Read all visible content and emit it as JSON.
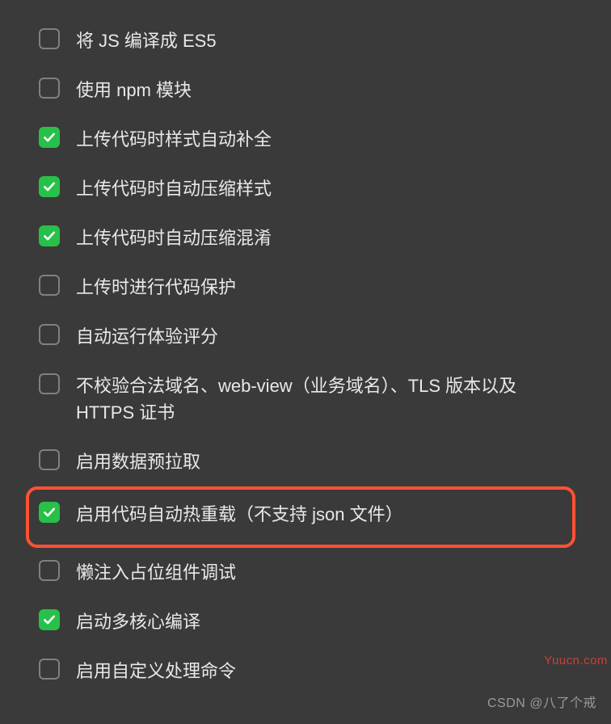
{
  "options": [
    {
      "label": "将 JS 编译成 ES5",
      "checked": false
    },
    {
      "label": "使用 npm 模块",
      "checked": false
    },
    {
      "label": "上传代码时样式自动补全",
      "checked": true
    },
    {
      "label": "上传代码时自动压缩样式",
      "checked": true
    },
    {
      "label": "上传代码时自动压缩混淆",
      "checked": true
    },
    {
      "label": "上传时进行代码保护",
      "checked": false
    },
    {
      "label": "自动运行体验评分",
      "checked": false
    },
    {
      "label": "不校验合法域名、web-view（业务域名）、TLS 版本以及 HTTPS 证书",
      "checked": false
    },
    {
      "label": "启用数据预拉取",
      "checked": false
    },
    {
      "label": "启用代码自动热重载（不支持 json 文件）",
      "checked": true,
      "highlighted": true
    },
    {
      "label": "懒注入占位组件调试",
      "checked": false
    },
    {
      "label": "启动多核心编译",
      "checked": true
    },
    {
      "label": "启用自定义处理命令",
      "checked": false
    }
  ],
  "watermark": {
    "bottom": "CSDN @八了个戒",
    "side": "Yuucn.com"
  }
}
